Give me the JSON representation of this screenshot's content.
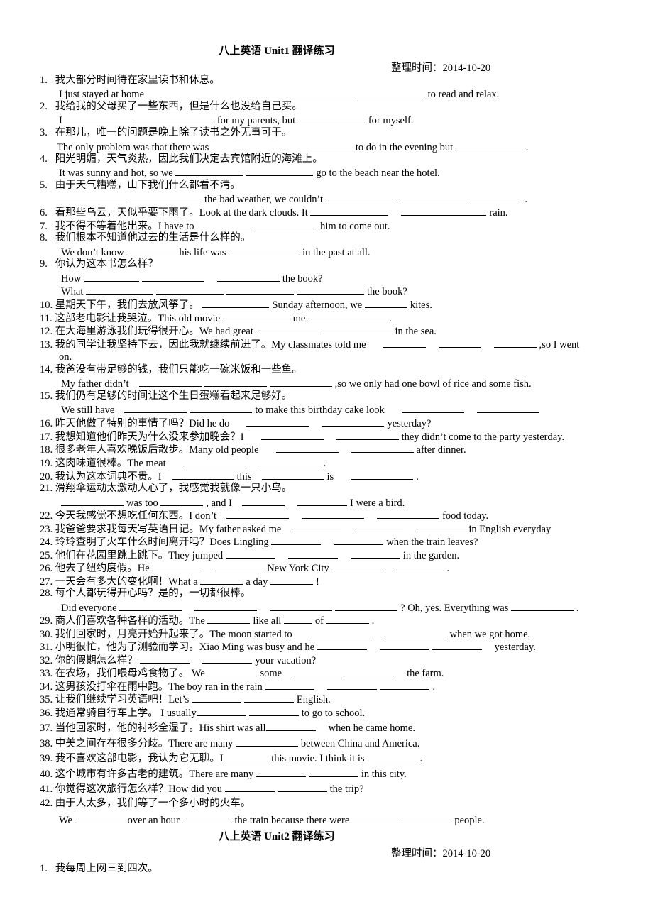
{
  "unit1": {
    "title": "八上英语 Unit1 翻译练习",
    "date": "整理时间：2014-10-20",
    "items": [
      {
        "n": "1.",
        "cn": "我大部分时间待在家里读书和休息。",
        "en": [
          "I just stayed at home",
          "to read and relax."
        ]
      },
      {
        "n": "2.",
        "cn": "我给我的父母买了一些东西，但是什么也没给自己买。",
        "en": [
          "I",
          "for my parents, but",
          "for myself."
        ]
      },
      {
        "n": "3.",
        "cn": "在那儿，唯一的问题是晚上除了读书之外无事可干。",
        "en": [
          "The only problem was that there was",
          "to do in the evening but",
          "."
        ]
      },
      {
        "n": "4.",
        "cn": "阳光明媚，天气炎热，因此我们决定去宾馆附近的海滩上。",
        "en": [
          "It was sunny and hot, so we",
          "go to the beach near the hotel."
        ]
      },
      {
        "n": "5.",
        "cn": "由于天气糟糕，山下我们什么都看不清。",
        "en": [
          "the bad weather, we couldn’t",
          "."
        ]
      },
      {
        "n": "6.",
        "cn": "看那些乌云，天似乎要下雨了。Look at the dark clouds. It",
        "en": [
          "rain."
        ]
      },
      {
        "n": "7.",
        "cn": "我不得不等着他出来。I have to",
        "en": [
          "him to come out."
        ]
      },
      {
        "n": "8.",
        "cn": "我们根本不知道他过去的生活是什么样的。",
        "en": [
          "We don’t know",
          "his life was",
          "in the past at all."
        ]
      },
      {
        "n": "9.",
        "cn": "你认为这本书怎么样？",
        "en": [
          "How",
          "the book?",
          "What",
          "the book?"
        ]
      },
      {
        "n": "10.",
        "cn": "星期天下午，我们去放风筝了。",
        "en": [
          "Sunday afternoon, we",
          "kites."
        ]
      },
      {
        "n": "11.",
        "cn": "这部老电影让我哭泣。This old movie",
        "en": [
          "me",
          "."
        ]
      },
      {
        "n": "12.",
        "cn": "在大海里游泳我们玩得很开心。We had great",
        "en": [
          "in the sea."
        ]
      },
      {
        "n": "13.",
        "cn": "我的同学让我坚持下去，因此我就继续前进了。My classmates told me",
        "en": [
          ",so I went",
          "on."
        ]
      },
      {
        "n": "14.",
        "cn": "我爸没有带足够的钱，我们只能吃一碗米饭和一些鱼。",
        "en": [
          "My father didn’t",
          ",so we only had one bowl of rice and some fish."
        ]
      },
      {
        "n": "15.",
        "cn": "我们仍有足够的时间让这个生日蛋糕看起来足够好。",
        "en": [
          "We still have",
          "to make this birthday cake look"
        ]
      },
      {
        "n": "16.",
        "cn": "昨天他做了特别的事情了吗？Did he do",
        "en": [
          "yesterday?"
        ]
      },
      {
        "n": "17.",
        "cn": "我想知道他们昨天为什么没来参加晚会？I",
        "en": [
          "they didn’t come to the party yesterday."
        ]
      },
      {
        "n": "18.",
        "cn": "很多老年人喜欢晚饭后散步。Many old people",
        "en": [
          "after dinner."
        ]
      },
      {
        "n": "19.",
        "cn": "这肉味道很棒。The meat",
        "en": [
          "."
        ]
      },
      {
        "n": "20.",
        "cn": "我认为这本词典不贵。I",
        "en": [
          "this",
          "is",
          "."
        ]
      },
      {
        "n": "21.",
        "cn": "滑翔伞运动太激动人心了，我感觉我就像一只小鸟。",
        "en": [
          "was too",
          ", and I",
          "I were a bird."
        ]
      },
      {
        "n": "22.",
        "cn": "今天我感觉不想吃任何东西。I don’t",
        "en": [
          "food today."
        ]
      },
      {
        "n": "23.",
        "cn": "我爸爸要求我每天写英语日记。My father asked me",
        "en": [
          "in English everyday"
        ]
      },
      {
        "n": "24.",
        "cn": "玲玲查明了火车什么时间离开吗？Does Lingling",
        "en": [
          "when the train leaves?"
        ]
      },
      {
        "n": "25.",
        "cn": "他们在花园里跳上跳下。They jumped",
        "en": [
          "in the garden."
        ]
      },
      {
        "n": "26.",
        "cn": "他去了纽约度假。He",
        "en": [
          "New York City",
          "."
        ]
      },
      {
        "n": "27.",
        "cn": "一天会有多大的变化啊！What a",
        "en": [
          "a day",
          "!"
        ]
      },
      {
        "n": "28.",
        "cn": "每个人都玩得开心吗？是的，一切都很棒。",
        "en": [
          "Did everyone",
          "? Oh, yes. Everything was",
          "."
        ]
      },
      {
        "n": "29.",
        "cn": "商人们喜欢各种各样的活动。The",
        "en": [
          "like all",
          "of",
          "."
        ]
      },
      {
        "n": "30.",
        "cn": "我们回家时，月亮开始升起来了。The moon started to",
        "en": [
          "when we got home."
        ]
      },
      {
        "n": "31.",
        "cn": "小明很忙，他为了测验而学习。Xiao Ming was busy and he",
        "en": [
          "yesterday."
        ]
      },
      {
        "n": "32.",
        "cn": "你的假期怎么样？",
        "en": [
          "your vacation?"
        ]
      },
      {
        "n": "33.",
        "cn": "在农场，我们喂母鸡食物了。 We",
        "en": [
          "some",
          "the farm."
        ]
      },
      {
        "n": "34.",
        "cn": "这男孩没打伞在雨中跑。The boy ran in the rain",
        "en": [
          "."
        ]
      },
      {
        "n": "35.",
        "cn": "让我们继续学习英语吧！Let’s",
        "en": [
          "English."
        ]
      },
      {
        "n": "36.",
        "cn": "我通常骑自行车上学。 I usually",
        "en": [
          "to go to school."
        ]
      },
      {
        "n": "37.",
        "cn": "当他回家时，他的衬衫全湿了。His shirt was all",
        "en": [
          "when he came home."
        ]
      },
      {
        "n": "38.",
        "cn": "中美之间存在很多分歧。There are many",
        "en": [
          "between China and America."
        ]
      },
      {
        "n": "39.",
        "cn": "我不喜欢这部电影，我认为它无聊。I",
        "en": [
          "this movie. I think it is",
          "."
        ]
      },
      {
        "n": "40.",
        "cn": "这个城市有许多古老的建筑。There are many",
        "en": [
          "in this city."
        ]
      },
      {
        "n": "41.",
        "cn": "你觉得这次旅行怎么样？How did you",
        "en": [
          "the trip?"
        ]
      },
      {
        "n": "42.",
        "cn": "由于人太多，我们等了一个多小时的火车。",
        "en": [
          "We",
          "over an hour",
          "the train because there were",
          "people."
        ]
      }
    ]
  },
  "unit2": {
    "title": "八上英语 Unit2 翻译练习",
    "date": "整理时间：2014-10-20",
    "items": [
      {
        "n": "1.",
        "cn": "我每周上网三到四次。"
      }
    ]
  }
}
